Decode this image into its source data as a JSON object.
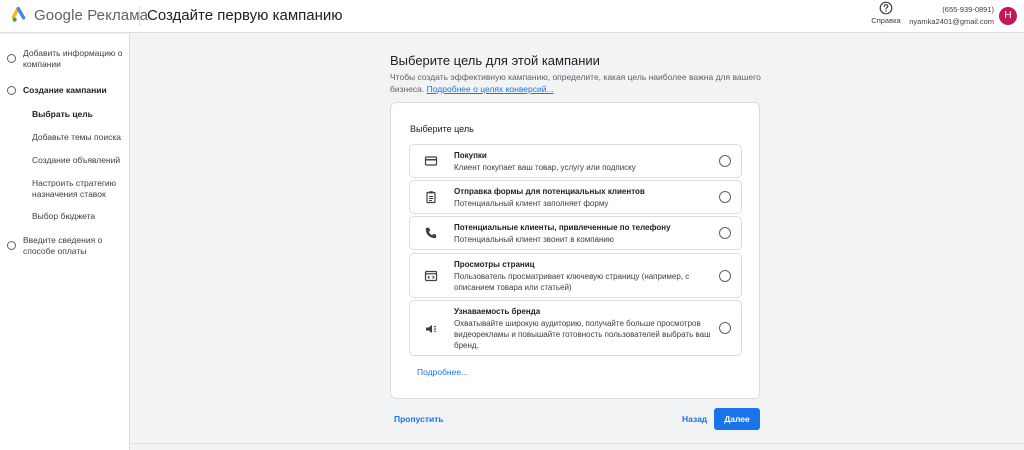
{
  "header": {
    "brand": "Google Реклама",
    "page_title": "Создайте первую кампанию",
    "help_label": "Справка",
    "account_id": "(655-939-0891)",
    "account_email": "nyamka2401@gmail.com",
    "avatar_letter": "H",
    "avatar_color": "#c2185b"
  },
  "sidebar": {
    "steps": [
      {
        "label": "Добавить информацию о компании"
      },
      {
        "label": "Создание кампании"
      },
      {
        "label": "Введите сведения о способе оплаты"
      }
    ],
    "substeps": [
      {
        "label": "Выбрать цель"
      },
      {
        "label": "Добавьте темы поиска"
      },
      {
        "label": "Создание объявлений"
      },
      {
        "label": "Настроить стратегию назначения ставок"
      },
      {
        "label": "Выбор бюджета"
      }
    ]
  },
  "main": {
    "title": "Выберите цель для этой кампании",
    "description": "Чтобы создать эффективную кампанию, определите, какая цель наиболее важна для вашего бизнеса.",
    "description_link": "Подробнее о целях конверсий...",
    "card_title": "Выберите цель",
    "options": [
      {
        "icon": "credit-card-icon",
        "name": "Покупки",
        "description": "Клиент покупает ваш товар, услугу или подписку"
      },
      {
        "icon": "clipboard-form-icon",
        "name": "Отправка формы для потенциальных клиентов",
        "description": "Потенциальный клиент заполняет форму"
      },
      {
        "icon": "phone-icon",
        "name": "Потенциальные клиенты, привлеченные по телефону",
        "description": "Потенциальный клиент звонит в компанию"
      },
      {
        "icon": "web-page-icon",
        "name": "Просмотры страниц",
        "description": "Пользователь просматривает ключевую страницу (например, с описанием товара или статьей)"
      },
      {
        "icon": "megaphone-icon",
        "name": "Узнаваемость бренда",
        "description": "Охватывайте широкую аудиторию, получайте больше просмотров видеорекламы и повышайте готовность пользователей выбрать ваш бренд."
      }
    ],
    "more_link": "Подробнее...",
    "skip_label": "Пропустить",
    "back_label": "Назад",
    "next_label": "Далее",
    "accent_color": "#1a73e8"
  }
}
